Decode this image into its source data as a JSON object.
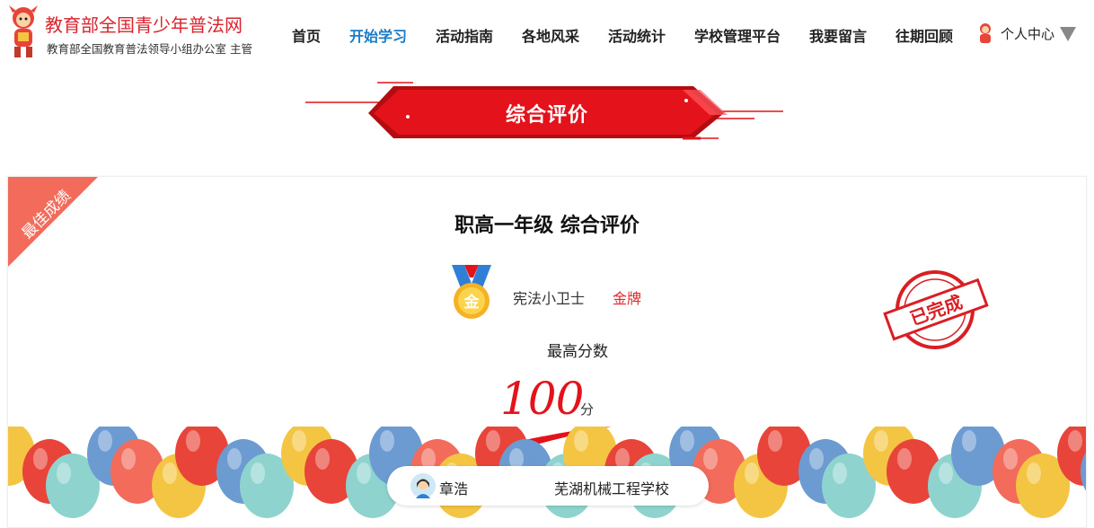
{
  "site": {
    "title": "教育部全国青少年普法网",
    "subtitle": "教育部全国教育普法领导小组办公室 主管"
  },
  "nav": {
    "items": [
      {
        "label": "首页"
      },
      {
        "label": "开始学习",
        "active": true
      },
      {
        "label": "活动指南"
      },
      {
        "label": "各地风采"
      },
      {
        "label": "活动统计"
      },
      {
        "label": "学校管理平台"
      },
      {
        "label": "我要留言"
      },
      {
        "label": "往期回顾"
      }
    ],
    "user_center": "个人中心"
  },
  "banner": {
    "title": "综合评价"
  },
  "card": {
    "corner_ribbon": "最佳成绩",
    "title": "职高一年级 综合评价",
    "medal_name": "宪法小卫士",
    "medal_level": "金牌",
    "medal_glyph": "金",
    "score_label": "最高分数",
    "score": "100",
    "score_unit": "分",
    "stamp_text": "已完成",
    "student_name": "章浩",
    "school": "芜湖机械工程学校"
  },
  "colors": {
    "accent_red": "#e4131b",
    "nav_active": "#1a7bc6",
    "corner_ribbon": "#f26b5b",
    "gold": "#f5b323"
  }
}
